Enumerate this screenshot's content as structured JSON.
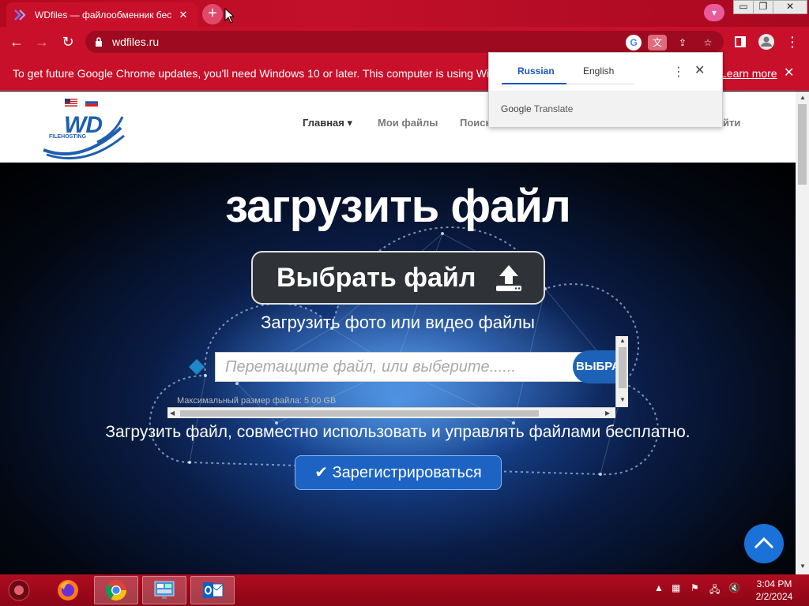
{
  "browser": {
    "tab_title": "WDfiles — файлообменник бес",
    "tab_close": "✕",
    "new_tab": "+",
    "url": "wdfiles.ru",
    "window_minimize": "▭",
    "window_restore": "❐",
    "window_close": "✕",
    "profile_badge": "▾"
  },
  "toolbar": {
    "back": "←",
    "forward": "→",
    "reload": "↻",
    "menu": "⋮"
  },
  "infobar": {
    "message": "To get future Google Chrome updates, you'll need Windows 10 or later. This computer is using Windows a",
    "link": "Learn more",
    "close": "✕"
  },
  "translate_bubble": {
    "languages": [
      "Russian",
      "English"
    ],
    "active_language": "Russian",
    "menu": "⋮",
    "close": "✕",
    "brand_google": "Google",
    "brand_translate": "Translate"
  },
  "site": {
    "logo_text": "WD",
    "logo_sub": "FILEHOSTING",
    "nav": [
      {
        "label": "Главная ▾"
      },
      {
        "label": "Мои файлы"
      },
      {
        "label": "Поиск"
      },
      {
        "label": "йти"
      }
    ],
    "hero_title": "загрузить файл",
    "choose_button": "Выбрать файл",
    "upload_subtitle": "Загрузить фото или видео файлы",
    "drop_placeholder": "Перетащите файл, или выберите......",
    "pick_button": "ВЫБРАТЬ",
    "max_size": "Максимальный размер файла: 5.00 GB",
    "tagline": "Загрузить файл, совместно использовать и управлять файлами бесплатно.",
    "register_button": "Зарегистрироваться"
  },
  "taskbar": {
    "apps": [
      "start-orb",
      "firefox",
      "chrome",
      "control-panel",
      "outlook"
    ],
    "active_app": "chrome",
    "time": "3:04 PM",
    "date": "2/2/2024"
  },
  "colors": {
    "chrome_frame": "#c8102a",
    "site_accent": "#1c63c4",
    "hero_bg": "#0a1c45"
  }
}
